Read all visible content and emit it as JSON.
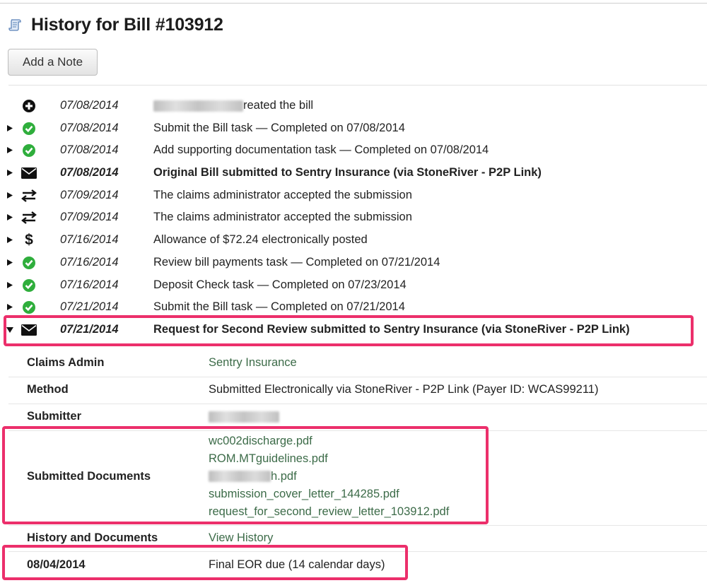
{
  "page": {
    "title": "History for Bill #103912",
    "add_note_label": "Add a Note"
  },
  "events": [
    {
      "icon": "plus-circle-icon",
      "date": "07/08/2014",
      "desc": "reated the bill",
      "redacted_prefix": true,
      "expandable": false,
      "bold": false
    },
    {
      "icon": "check-circle-icon",
      "date": "07/08/2014",
      "desc": "Submit the Bill task — Completed on 07/08/2014",
      "expandable": true,
      "bold": false
    },
    {
      "icon": "check-circle-icon",
      "date": "07/08/2014",
      "desc": "Add supporting documentation task — Completed on 07/08/2014",
      "expandable": true,
      "bold": false
    },
    {
      "icon": "envelope-icon",
      "date": "07/08/2014",
      "desc": "Original Bill submitted to Sentry Insurance (via StoneRiver - P2P Link)",
      "expandable": true,
      "bold": true
    },
    {
      "icon": "exchange-icon",
      "date": "07/09/2014",
      "desc": "The claims administrator accepted the submission",
      "expandable": true,
      "bold": false
    },
    {
      "icon": "exchange-icon",
      "date": "07/09/2014",
      "desc": "The claims administrator accepted the submission",
      "expandable": true,
      "bold": false
    },
    {
      "icon": "dollar-icon",
      "date": "07/16/2014",
      "desc": "Allowance of $72.24 electronically posted",
      "expandable": true,
      "bold": false
    },
    {
      "icon": "check-circle-icon",
      "date": "07/16/2014",
      "desc": "Review bill payments task — Completed on 07/21/2014",
      "expandable": true,
      "bold": false
    },
    {
      "icon": "check-circle-icon",
      "date": "07/16/2014",
      "desc": "Deposit Check task — Completed on 07/23/2014",
      "expandable": true,
      "bold": false
    },
    {
      "icon": "check-circle-icon",
      "date": "07/21/2014",
      "desc": "Submit the Bill task — Completed on 07/21/2014",
      "expandable": true,
      "bold": false
    },
    {
      "icon": "envelope-icon",
      "date": "07/21/2014",
      "desc": "Request for Second Review submitted to Sentry Insurance (via StoneRiver - P2P Link)",
      "expandable": true,
      "expanded": true,
      "bold": true
    }
  ],
  "details": {
    "claims_admin_label": "Claims Admin",
    "claims_admin_value": "Sentry Insurance",
    "method_label": "Method",
    "method_value": "Submitted Electronically via StoneRiver - P2P Link (Payer ID: WCAS99211)",
    "submitter_label": "Submitter",
    "submitted_documents_label": "Submitted Documents",
    "documents": [
      "wc002discharge.pdf",
      "ROM.MTguidelines.pdf",
      "h.pdf",
      "submission_cover_letter_144285.pdf",
      "request_for_second_review_letter_103912.pdf"
    ],
    "history_label": "History and Documents",
    "history_link": "View History",
    "due_date": "08/04/2014",
    "due_text": "Final EOR due (14 calendar days)"
  },
  "colors": {
    "link": "#3c6b48",
    "check_green": "#2fae3c",
    "highlight": "#ec2f6b"
  }
}
